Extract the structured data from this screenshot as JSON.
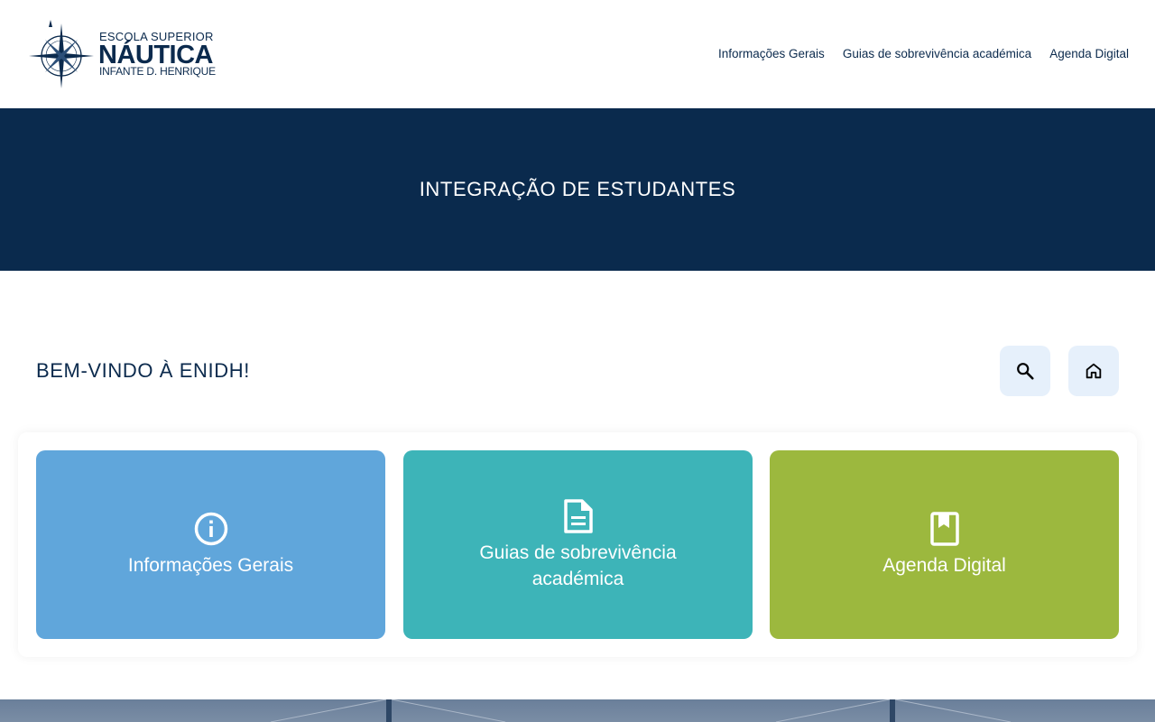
{
  "header": {
    "logo": {
      "line1": "ESCOLA SUPERIOR",
      "line2": "NÁUTICA",
      "line3": "INFANTE D. HENRIQUE"
    },
    "nav": [
      {
        "label": "Informações Gerais"
      },
      {
        "label": "Guias de sobrevivência académica"
      },
      {
        "label": "Agenda Digital"
      }
    ]
  },
  "hero": {
    "title": "INTEGRAÇÃO DE ESTUDANTES"
  },
  "welcome": {
    "title": "BEM-VINDO À ENIDH!",
    "buttons": [
      {
        "icon": "search-icon"
      },
      {
        "icon": "home-icon"
      }
    ]
  },
  "cards": [
    {
      "label": "Informações Gerais",
      "icon": "info-icon",
      "color": "#60a6db"
    },
    {
      "label": "Guias de sobrevivência académica",
      "icon": "document-icon",
      "color": "#3db4b8"
    },
    {
      "label": "Agenda Digital",
      "icon": "bookmark-book-icon",
      "color": "#9cb83e"
    }
  ],
  "colors": {
    "brand_navy": "#0a2a4d",
    "button_bg": "#e6f0fb"
  }
}
